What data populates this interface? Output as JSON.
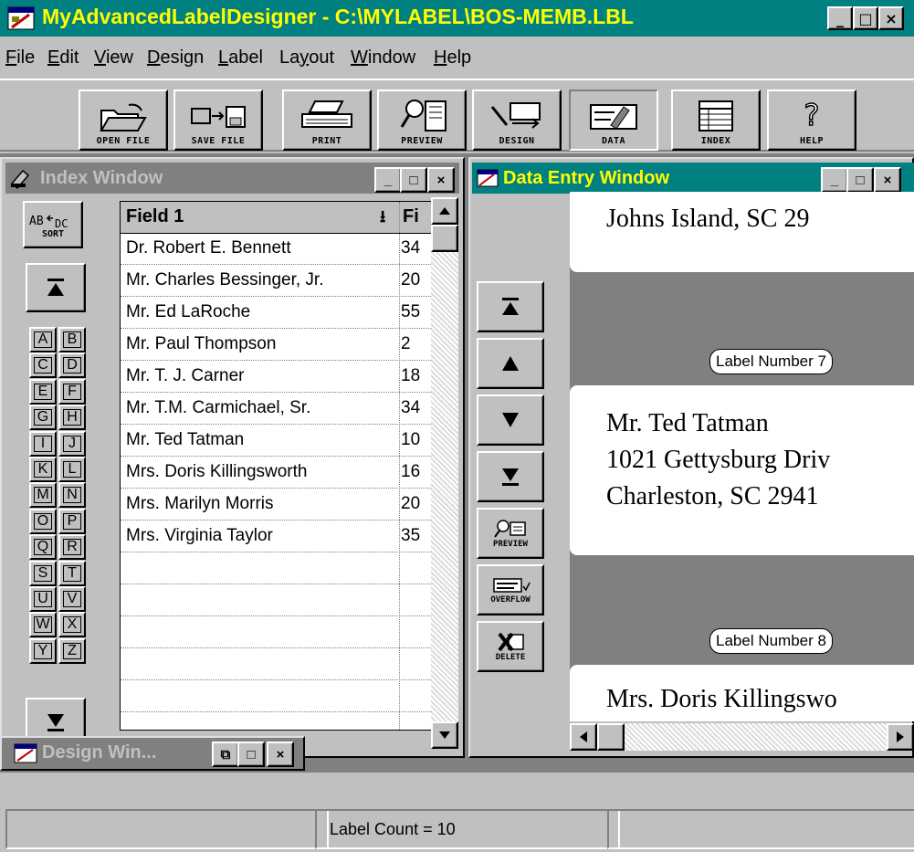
{
  "window": {
    "title": "MyAdvancedLabelDesigner - C:\\MYLABEL\\BOS-MEMB.LBL",
    "min_glyph": "_",
    "max_glyph": "□",
    "close_glyph": "×"
  },
  "menu": [
    "File",
    "Edit",
    "View",
    "Design",
    "Label",
    "Layout",
    "Window",
    "Help"
  ],
  "toolbar": {
    "buttons": [
      {
        "label": "OPEN FILE",
        "icon": "open-folder-icon"
      },
      {
        "label": "SAVE FILE",
        "icon": "save-disk-icon"
      },
      {
        "label": "PRINT",
        "icon": "printer-icon"
      },
      {
        "label": "PREVIEW",
        "icon": "preview-magnifier-icon"
      },
      {
        "label": "DESIGN",
        "icon": "design-tools-icon"
      },
      {
        "label": "DATA",
        "icon": "data-entry-icon"
      },
      {
        "label": "INDEX",
        "icon": "index-list-icon"
      },
      {
        "label": "HELP",
        "icon": "help-question-icon"
      }
    ]
  },
  "index_window": {
    "title": "Index Window",
    "sort_label": "SORT",
    "letters": [
      "A",
      "B",
      "C",
      "D",
      "E",
      "F",
      "G",
      "H",
      "I",
      "J",
      "K",
      "L",
      "M",
      "N",
      "O",
      "P",
      "Q",
      "R",
      "S",
      "T",
      "U",
      "V",
      "W",
      "X",
      "Y",
      "Z"
    ],
    "column1": "Field 1",
    "column2": "Fi",
    "rows": [
      {
        "name": "Dr. Robert E. Bennett",
        "f2": "34"
      },
      {
        "name": "Mr. Charles Bessinger, Jr.",
        "f2": "20"
      },
      {
        "name": "Mr. Ed LaRoche",
        "f2": "55"
      },
      {
        "name": "Mr. Paul Thompson",
        "f2": "2"
      },
      {
        "name": "Mr. T. J. Carner",
        "f2": "18"
      },
      {
        "name": "Mr. T.M. Carmichael, Sr.",
        "f2": "34"
      },
      {
        "name": "Mr. Ted Tatman",
        "f2": "10"
      },
      {
        "name": "Mrs. Doris Killingsworth",
        "f2": "16"
      },
      {
        "name": "Mrs. Marilyn Morris",
        "f2": "20"
      },
      {
        "name": "Mrs. Virginia Taylor",
        "f2": "35"
      }
    ]
  },
  "data_window": {
    "title": "Data Entry Window",
    "buttons": {
      "preview": "PREVIEW",
      "overflow": "OVERFLOW",
      "delete": "DELETE"
    },
    "label_prev_line": "Johns Island, SC 29",
    "label7_number": "Label Number 7",
    "label7_lines": [
      "Mr. Ted Tatman",
      "1021 Gettysburg Driv",
      "Charleston, SC 2941"
    ],
    "label8_number": "Label Number 8",
    "label8_line": "Mrs. Doris Killingswo"
  },
  "design_window": {
    "title": "Design Win..."
  },
  "status": {
    "label_count": "Label Count = 10"
  },
  "colors": {
    "title_bar": "#008080",
    "title_text": "#ffff00",
    "face": "#c0c0c0",
    "workspace": "#808080"
  }
}
